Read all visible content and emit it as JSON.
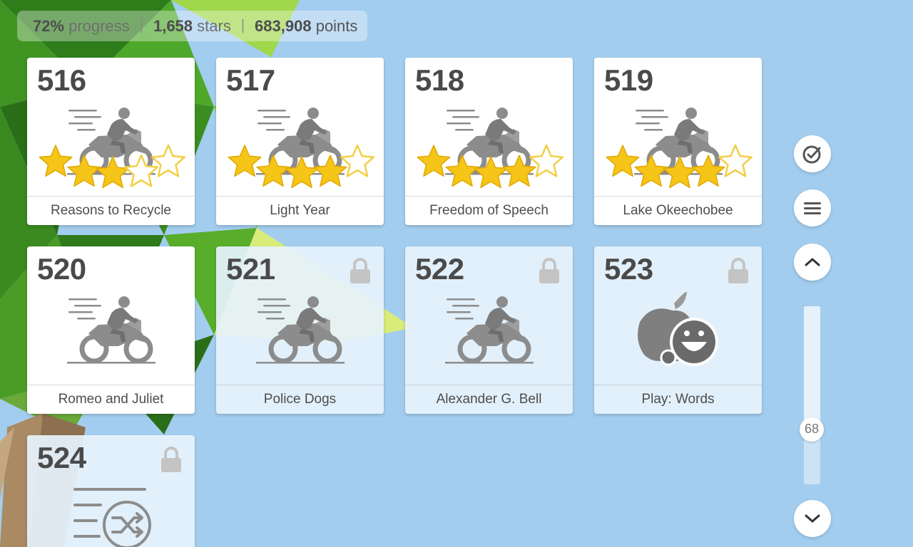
{
  "stats": {
    "progress_value": "72%",
    "progress_label": "progress",
    "stars_value": "1,658",
    "stars_label": "stars",
    "points_value": "683,908",
    "points_label": "points",
    "separator": "|"
  },
  "cards": [
    {
      "number": "516",
      "title": "Reasons to Recycle",
      "icon": "motorcycle-icon",
      "locked": false,
      "stars": 3,
      "max_stars": 5
    },
    {
      "number": "517",
      "title": "Light Year",
      "icon": "motorcycle-icon",
      "locked": false,
      "stars": 4,
      "max_stars": 5
    },
    {
      "number": "518",
      "title": "Freedom of Speech",
      "icon": "motorcycle-icon",
      "locked": false,
      "stars": 4,
      "max_stars": 5
    },
    {
      "number": "519",
      "title": "Lake Okeechobee",
      "icon": "motorcycle-icon",
      "locked": false,
      "stars": 4,
      "max_stars": 5
    },
    {
      "number": "520",
      "title": "Romeo and Juliet",
      "icon": "motorcycle-icon",
      "locked": false,
      "stars": 0,
      "max_stars": 0
    },
    {
      "number": "521",
      "title": "Police Dogs",
      "icon": "motorcycle-icon",
      "locked": true
    },
    {
      "number": "522",
      "title": "Alexander G. Bell",
      "icon": "motorcycle-icon",
      "locked": true
    },
    {
      "number": "523",
      "title": "Play: Words",
      "icon": "apple-mascot-icon",
      "locked": true
    },
    {
      "number": "524",
      "title": "",
      "icon": "shuffle-list-icon",
      "locked": true
    }
  ],
  "sidebar": {
    "buttons": [
      {
        "name": "check-icon"
      },
      {
        "name": "menu-icon"
      },
      {
        "name": "chevron-up-icon"
      },
      {
        "name": "chevron-down-icon"
      }
    ],
    "scroll_value": "68",
    "scroll_fraction": 0.72
  },
  "colors": {
    "sky": "#a3cdee",
    "star_gold": "#f5c518",
    "icon_gray": "#8c8c8c",
    "locked_card": "#e6f2fc"
  }
}
